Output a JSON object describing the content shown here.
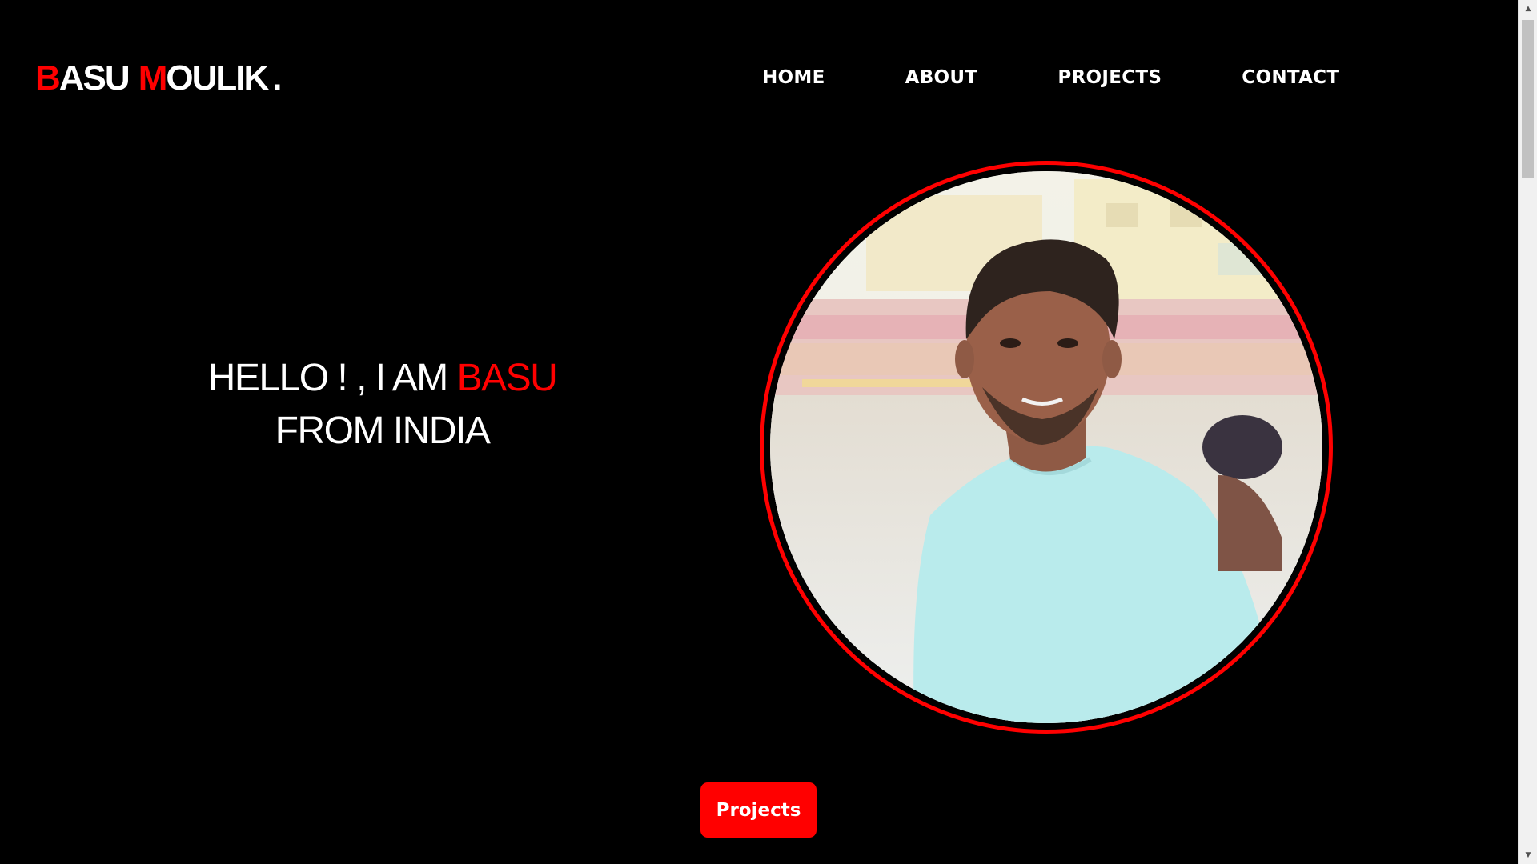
{
  "logo": {
    "first_initial": "B",
    "first_rest": "ASU",
    "last_initial": "M",
    "last_rest": "OULIK",
    "dot": "."
  },
  "nav": {
    "home": "HOME",
    "about": "ABOUT",
    "projects": "PROJECTS",
    "contact": "CONTACT"
  },
  "hero": {
    "line1_prefix": "HELLO ! , I AM ",
    "line1_highlight": "BASU",
    "line2": "FROM INDIA"
  },
  "portrait": {
    "alt": "profile photo"
  },
  "cta": {
    "projects_label": "Projects"
  },
  "colors": {
    "background": "#000000",
    "accent": "#ff0000",
    "text": "#ffffff"
  },
  "scrollbar": {
    "up_icon": "triangle-up",
    "down_icon": "triangle-down"
  }
}
